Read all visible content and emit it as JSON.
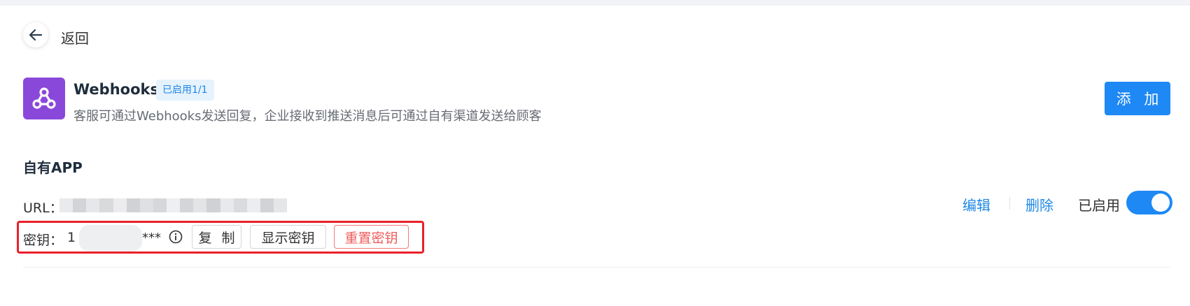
{
  "header": {
    "back_label": "返回"
  },
  "integration": {
    "title": "Webhooks",
    "badge": "已启用1/1",
    "description": "客服可通过Webhooks发送回复，企业接收到推送消息后可通过自有渠道发送给顾客",
    "add_button": "添 加",
    "logo_color": "#8a48db"
  },
  "section": {
    "title": "自有APP",
    "url_label": "URL：",
    "key_label": "密钥：",
    "key_visible_prefix": "1",
    "key_masked_suffix": "***",
    "copy_button": "复 制",
    "show_key_button": "显示密钥",
    "reset_key_button": "重置密钥",
    "edit_link": "编辑",
    "delete_link": "删除",
    "status_text": "已启用",
    "enabled": true
  },
  "colors": {
    "primary": "#1e88f5",
    "danger": "#f05a5a",
    "highlight": "#e8212a"
  }
}
